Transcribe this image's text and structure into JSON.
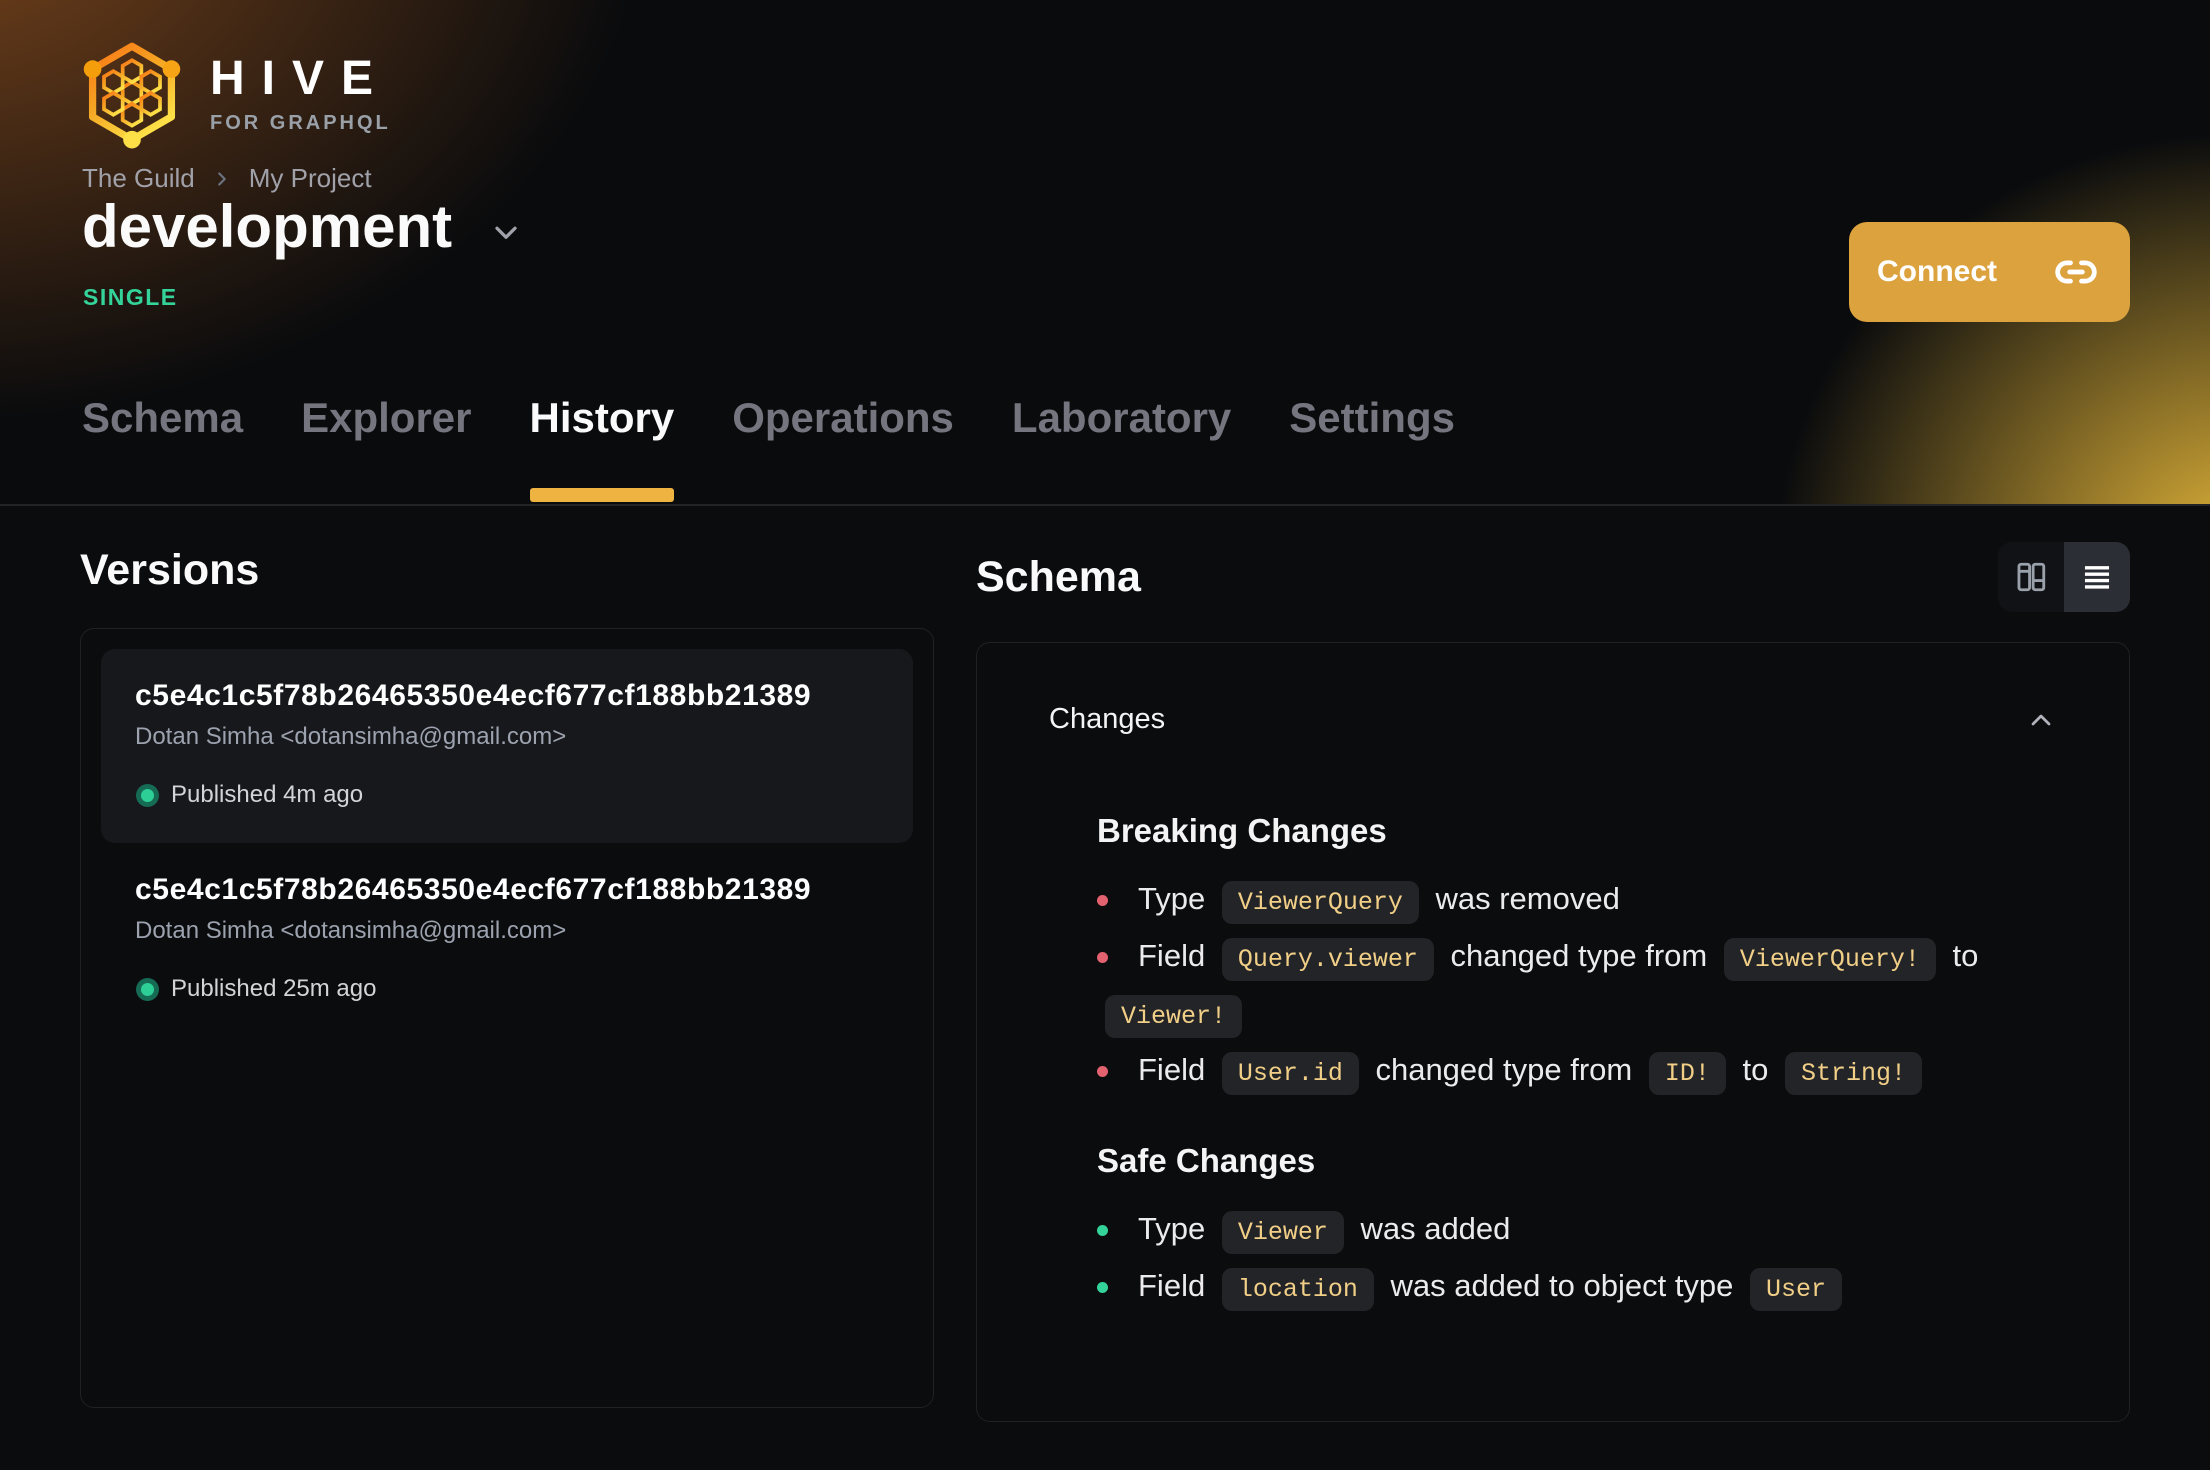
{
  "brand": {
    "name": "HIVE",
    "tagline": "FOR GRAPHQL"
  },
  "breadcrumb": {
    "org": "The Guild",
    "project": "My Project"
  },
  "target": {
    "name": "development",
    "badge": "SINGLE"
  },
  "connect": {
    "label": "Connect"
  },
  "tabs": [
    {
      "label": "Schema",
      "active": false
    },
    {
      "label": "Explorer",
      "active": false
    },
    {
      "label": "History",
      "active": true
    },
    {
      "label": "Operations",
      "active": false
    },
    {
      "label": "Laboratory",
      "active": false
    },
    {
      "label": "Settings",
      "active": false
    }
  ],
  "versions": {
    "title": "Versions",
    "items": [
      {
        "hash": "c5e4c1c5f78b26465350e4ecf677cf188bb21389",
        "author": "Dotan Simha <dotansimha@gmail.com>",
        "status": "Published 4m ago",
        "selected": true
      },
      {
        "hash": "c5e4c1c5f78b26465350e4ecf677cf188bb21389",
        "author": "Dotan Simha <dotansimha@gmail.com>",
        "status": "Published 25m ago",
        "selected": false
      }
    ]
  },
  "schema_panel": {
    "title": "Schema",
    "changes_label": "Changes",
    "breaking": {
      "title": "Breaking Changes",
      "items": [
        {
          "parts": [
            {
              "text": "Type "
            },
            {
              "code": "ViewerQuery"
            },
            {
              "text": " was removed"
            }
          ]
        },
        {
          "parts": [
            {
              "text": "Field "
            },
            {
              "code": "Query.viewer"
            },
            {
              "text": " changed type from "
            },
            {
              "code": "ViewerQuery!"
            },
            {
              "text": " to "
            },
            {
              "code": "Viewer!"
            }
          ]
        },
        {
          "parts": [
            {
              "text": "Field "
            },
            {
              "code": "User.id"
            },
            {
              "text": " changed type from "
            },
            {
              "code": "ID!"
            },
            {
              "text": " to "
            },
            {
              "code": "String!"
            }
          ]
        }
      ]
    },
    "safe": {
      "title": "Safe Changes",
      "items": [
        {
          "parts": [
            {
              "text": "Type "
            },
            {
              "code": "Viewer"
            },
            {
              "text": " was added"
            }
          ]
        },
        {
          "parts": [
            {
              "text": "Field "
            },
            {
              "code": "location"
            },
            {
              "text": " was added to object type "
            },
            {
              "code": "User"
            }
          ]
        }
      ]
    }
  },
  "icons": {
    "logo": "hive-hexagon-logo",
    "breadcrumb_separator": "chevron-right-icon",
    "title_dropdown": "chevron-down-icon",
    "connect": "link-icon",
    "view_modes": [
      "columns-view-icon",
      "list-view-icon"
    ],
    "changes_collapse": "chevron-up-icon",
    "published": "green-dot-icon"
  },
  "colors": {
    "accent_amber": "#efb341",
    "button_amber": "#dca23d",
    "emerald": "#34d399",
    "status_dot": "#2ece97",
    "status_dot_ring": "#166b55",
    "breaking_bullet": "#e3626f",
    "safe_bullet": "#34d399",
    "chip_bg": "#232428",
    "chip_text": "#f1cf87"
  }
}
